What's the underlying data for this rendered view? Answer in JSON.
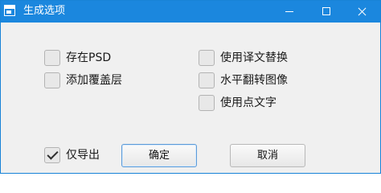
{
  "window": {
    "title": "生成选项"
  },
  "options": {
    "save_psd": {
      "label": "存在PSD",
      "checked": false
    },
    "add_overlay": {
      "label": "添加覆盖层",
      "checked": false
    },
    "use_translation_replace": {
      "label": "使用译文替换",
      "checked": false
    },
    "flip_horizontal": {
      "label": "水平翻转图像",
      "checked": false
    },
    "use_dot_text": {
      "label": "使用点文字",
      "checked": false
    },
    "export_only": {
      "label": "仅导出",
      "checked": true
    }
  },
  "buttons": {
    "ok": "确定",
    "cancel": "取消"
  },
  "icons": {
    "app": "app-window-icon",
    "minimize": "minimize-icon",
    "maximize": "maximize-icon",
    "close": "close-icon",
    "checked": "checkmark-icon"
  },
  "colors": {
    "titlebar": "#1b87de",
    "background": "#f0f0f0",
    "checkbox": "#e8e8e8",
    "focus_border": "#5d9bd8"
  }
}
